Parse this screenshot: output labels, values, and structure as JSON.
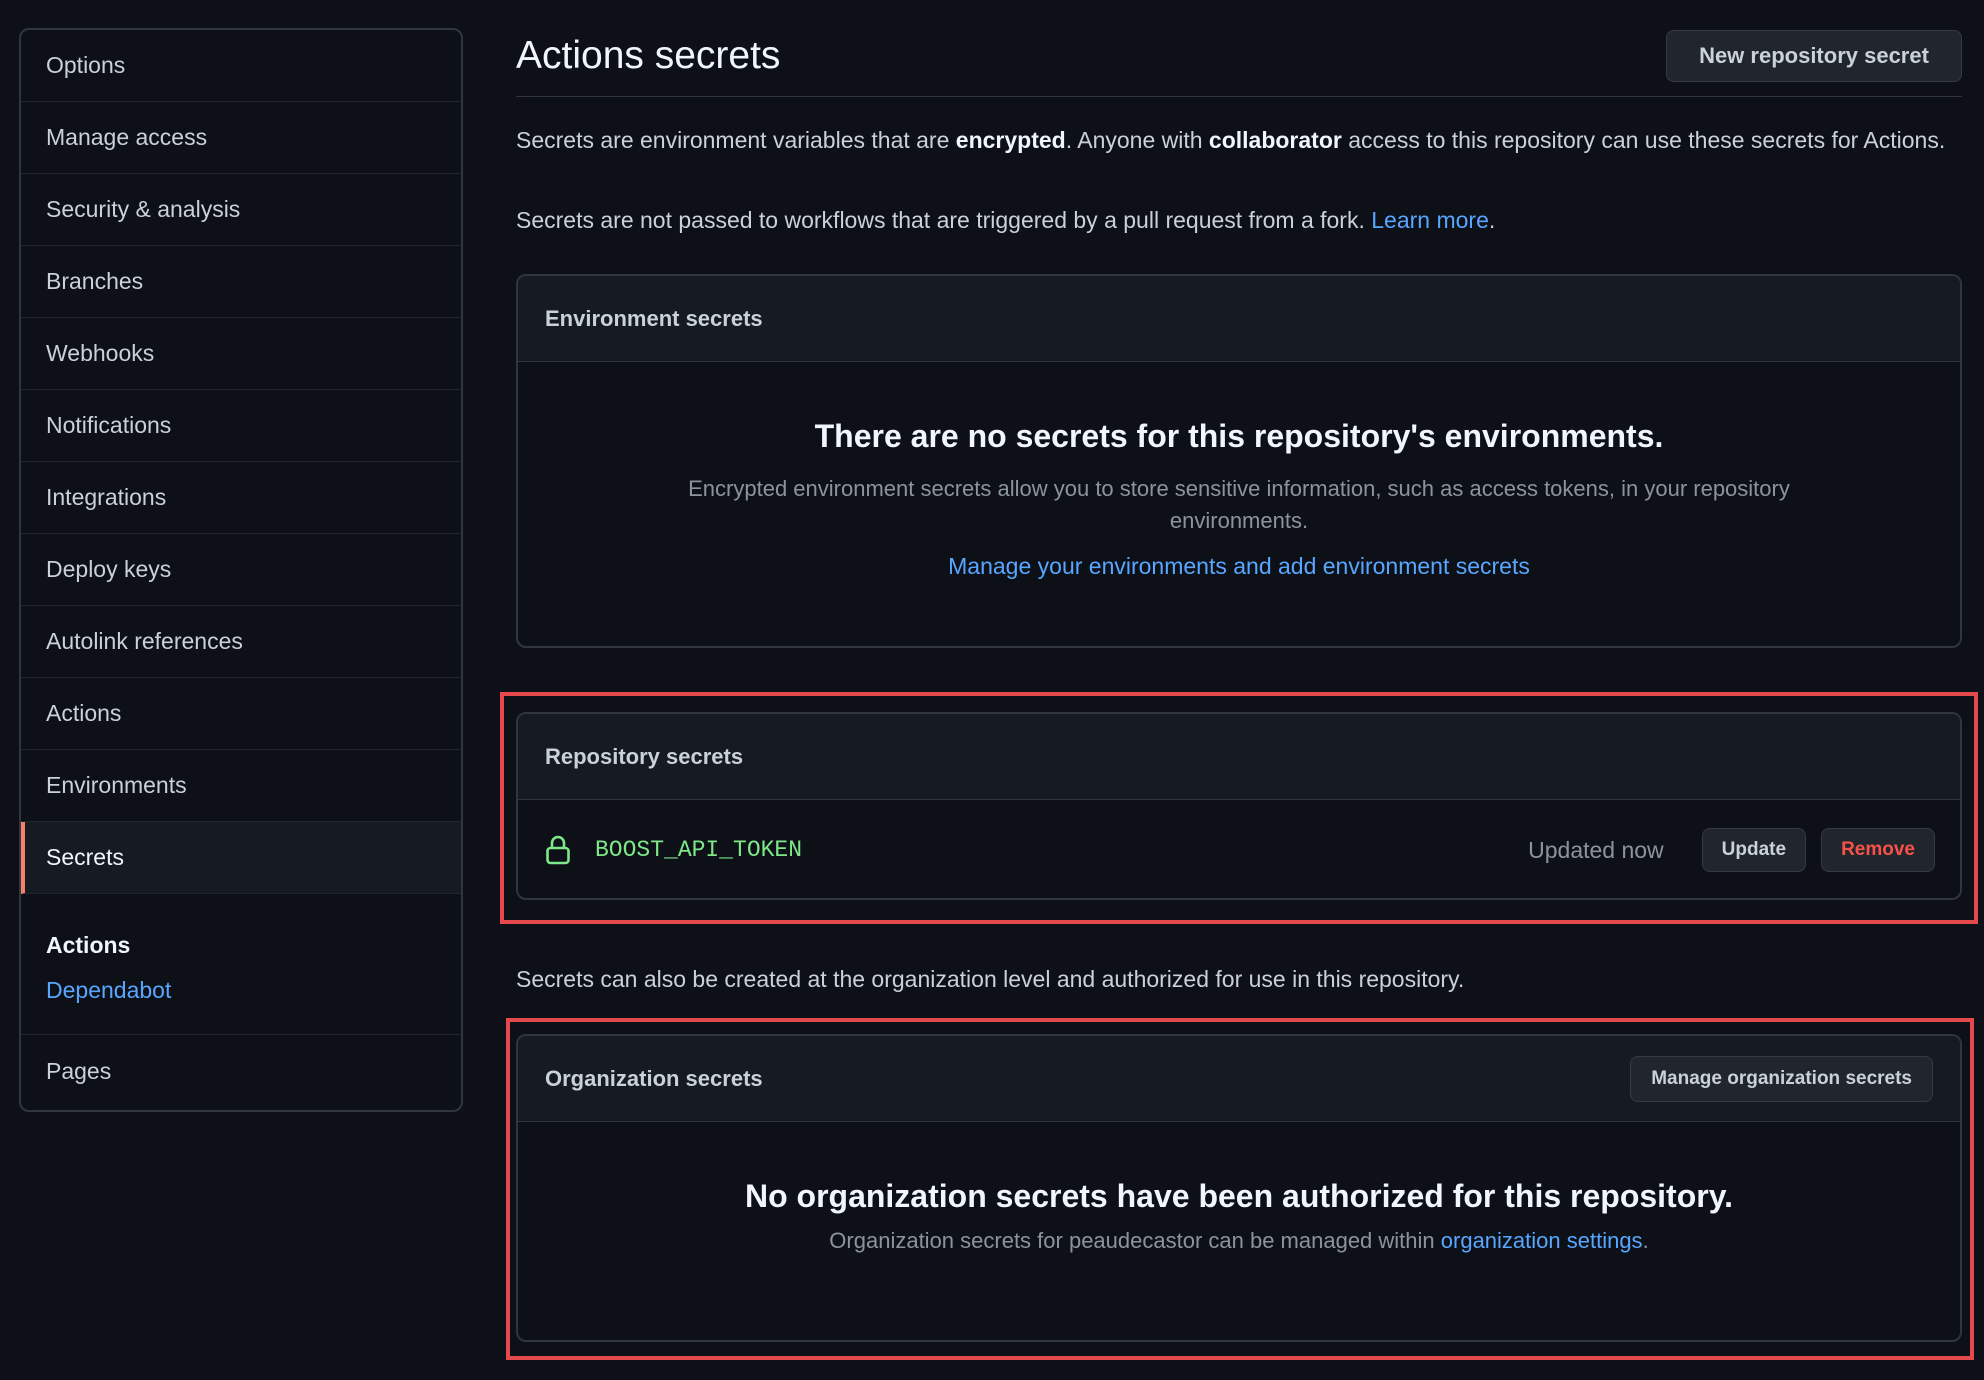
{
  "sidebar": {
    "items": [
      "Options",
      "Manage access",
      "Security & analysis",
      "Branches",
      "Webhooks",
      "Notifications",
      "Integrations",
      "Deploy keys",
      "Autolink references",
      "Actions",
      "Environments",
      "Secrets"
    ],
    "active": "Secrets",
    "group": {
      "title": "Actions",
      "link": "Dependabot"
    },
    "last_item": "Pages"
  },
  "header": {
    "title": "Actions secrets",
    "new_button": "New repository secret"
  },
  "description": {
    "p1_pre": "Secrets are environment variables that are ",
    "p1_bold1": "encrypted",
    "p1_mid": ". Anyone with ",
    "p1_bold2": "collaborator",
    "p1_post": " access to this repository can use these secrets for Actions.",
    "p2_pre": "Secrets are not passed to workflows that are triggered by a pull request from a fork. ",
    "p2_link": "Learn more",
    "p2_post": "."
  },
  "environment_secrets": {
    "heading": "Environment secrets",
    "blank_title": "There are no secrets for this repository's environments.",
    "blank_text": "Encrypted environment secrets allow you to store sensitive information, such as access tokens, in your repository environments.",
    "link": "Manage your environments and add environment secrets"
  },
  "repository_secrets": {
    "heading": "Repository secrets",
    "secret_name": "BOOST_API_TOKEN",
    "updated": "Updated now",
    "update_button": "Update",
    "remove_button": "Remove",
    "icon": "lock-icon"
  },
  "org_note": "Secrets can also be created at the organization level and authorized for use in this repository.",
  "organization_secrets": {
    "heading": "Organization secrets",
    "manage_button": "Manage organization secrets",
    "blank_title": "No organization secrets have been authorized for this repository.",
    "blank_pre": "Organization secrets for peaudecastor can be managed within ",
    "blank_link": "organization settings",
    "blank_post": "."
  },
  "colors": {
    "background": "#0d1117",
    "link": "#58a6ff",
    "secret_name": "#7ee787",
    "remove": "#f85149",
    "active_marker": "#f78166",
    "highlight": "#e5484d"
  }
}
